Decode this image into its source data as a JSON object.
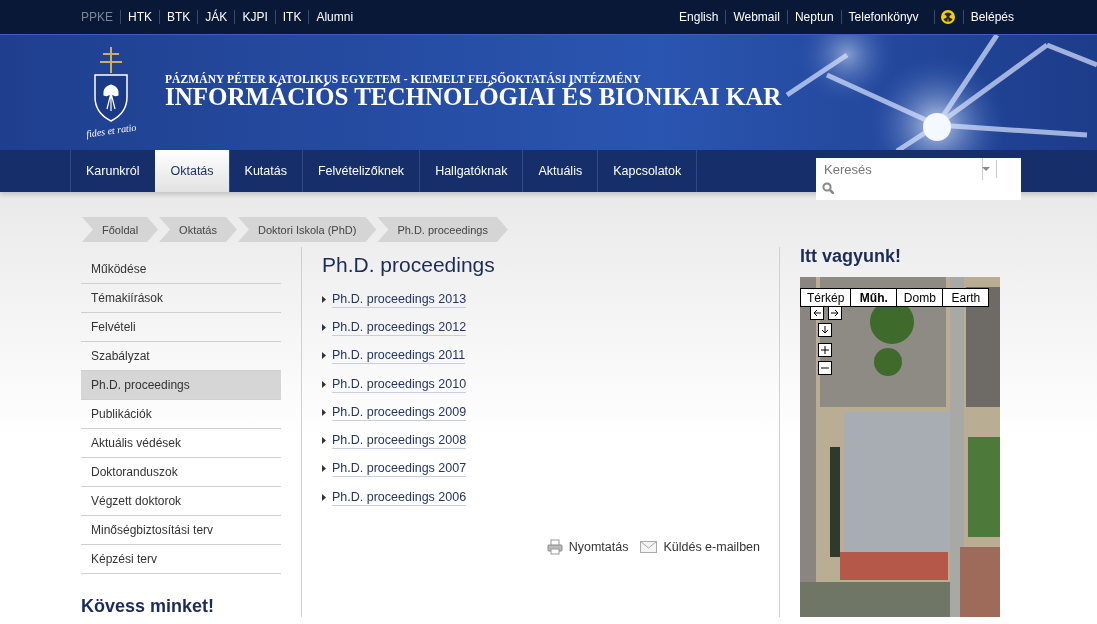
{
  "top_bar": {
    "left_links": [
      {
        "label": "PPKE",
        "selected": true
      },
      {
        "label": "HTK",
        "selected": false
      },
      {
        "label": "BTK",
        "selected": false
      },
      {
        "label": "JÁK",
        "selected": false
      },
      {
        "label": "KJPI",
        "selected": false
      },
      {
        "label": "ITK",
        "selected": false
      },
      {
        "label": "Alumni",
        "selected": false
      }
    ],
    "right_links": [
      {
        "kind": "link",
        "label": "English"
      },
      {
        "kind": "link",
        "label": "Webmail"
      },
      {
        "kind": "link",
        "label": "Neptun"
      },
      {
        "kind": "link",
        "label": "Telefonkönyv"
      },
      {
        "kind": "icon"
      },
      {
        "kind": "link",
        "label": "Belépés"
      }
    ]
  },
  "header": {
    "motto": "fides et ratio",
    "subtitle": "PÁZMÁNY PÉTER KATOLIKUS EGYETEM - KIEMELT FELSŐOKTATÁSI INTÉZMÉNY",
    "title": "INFORMÁCIÓS TECHNOLÓGIAI ÉS BIONIKAI KAR"
  },
  "nav": {
    "items": [
      {
        "label": "Karunkról",
        "selected": false
      },
      {
        "label": "Oktatás",
        "selected": true
      },
      {
        "label": "Kutatás",
        "selected": false
      },
      {
        "label": "Felvételizőknek",
        "selected": false
      },
      {
        "label": "Hallgatóknak",
        "selected": false
      },
      {
        "label": "Aktuális",
        "selected": false
      },
      {
        "label": "Kapcsolatok",
        "selected": false
      }
    ],
    "search": {
      "placeholder": "Keresés"
    }
  },
  "breadcrumb": [
    "Főoldal",
    "Oktatás",
    "Doktori Iskola (PhD)",
    "Ph.D. proceedings"
  ],
  "sidebar": {
    "items": [
      {
        "label": "Működése",
        "selected": false
      },
      {
        "label": "Témakiírások",
        "selected": false
      },
      {
        "label": "Felvételi",
        "selected": false
      },
      {
        "label": "Szabályzat",
        "selected": false
      },
      {
        "label": "Ph.D. proceedings",
        "selected": true
      },
      {
        "label": "Publikációk",
        "selected": false
      },
      {
        "label": "Aktuális védések",
        "selected": false
      },
      {
        "label": "Doktoranduszok",
        "selected": false
      },
      {
        "label": "Végzett doktorok",
        "selected": false
      },
      {
        "label": "Minőségbiztosítási terv",
        "selected": false
      },
      {
        "label": "Képzési terv",
        "selected": false
      }
    ],
    "follow_heading": "Kövess minket!"
  },
  "main": {
    "title": "Ph.D. proceedings",
    "links": [
      "Ph.D. proceedings 2013",
      "Ph.D. proceedings 2012",
      "Ph.D. proceedings 2011",
      "Ph.D. proceedings 2010",
      "Ph.D. proceedings 2009",
      "Ph.D. proceedings 2008",
      "Ph.D. proceedings 2007",
      "Ph.D. proceedings 2006"
    ],
    "actions": [
      {
        "kind": "print",
        "label": "Nyomtatás"
      },
      {
        "kind": "email",
        "label": "Küldés e-mailben"
      }
    ]
  },
  "map_panel": {
    "heading": "Itt vagyunk!",
    "map_types": [
      {
        "label": "Térkép",
        "selected": false
      },
      {
        "label": "Műh.",
        "selected": true
      },
      {
        "label": "Domb",
        "selected": false
      },
      {
        "label": "Earth",
        "selected": false
      }
    ]
  }
}
